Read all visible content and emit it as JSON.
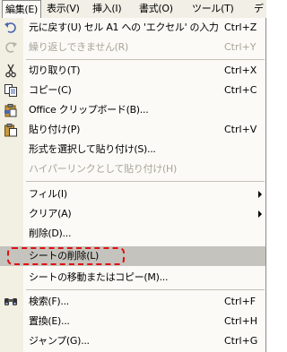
{
  "menubar": {
    "items": [
      {
        "label": "編集(E)"
      },
      {
        "label": "表示(V)"
      },
      {
        "label": "挿入(I)"
      },
      {
        "label": "書式(O)"
      },
      {
        "label": "ツール(T)"
      },
      {
        "label": "デ"
      }
    ]
  },
  "menu": {
    "items": [
      {
        "label": "元に戻す(U) セル A1 への 'エクセル' の入力",
        "shortcut": "Ctrl+Z",
        "icon": "undo-icon"
      },
      {
        "label": "繰り返しできません(R)",
        "shortcut": "Ctrl+Y",
        "icon": "redo-icon",
        "disabled": true
      },
      {
        "label": "切り取り(T)",
        "shortcut": "Ctrl+X",
        "icon": "cut-icon"
      },
      {
        "label": "コピー(C)",
        "shortcut": "Ctrl+C",
        "icon": "copy-icon"
      },
      {
        "label": "Office クリップボード(B)...",
        "icon": "clipboard-icon"
      },
      {
        "label": "貼り付け(P)",
        "shortcut": "Ctrl+V",
        "icon": "paste-icon"
      },
      {
        "label": "形式を選択して貼り付け(S)..."
      },
      {
        "label": "ハイパーリンクとして貼り付け(H)",
        "disabled": true
      },
      {
        "label": "フィル(I)",
        "submenu": true
      },
      {
        "label": "クリア(A)",
        "submenu": true
      },
      {
        "label": "削除(D)..."
      },
      {
        "label": "シートの削除(L)",
        "highlighted": true
      },
      {
        "label": "シートの移動またはコピー(M)..."
      },
      {
        "label": "検索(F)...",
        "shortcut": "Ctrl+F",
        "icon": "find-icon"
      },
      {
        "label": "置換(E)...",
        "shortcut": "Ctrl+H"
      },
      {
        "label": "ジャンプ(G)...",
        "shortcut": "Ctrl+G"
      }
    ]
  },
  "colors": {
    "highlight_annotation": "#e01010",
    "menu_background": "#fbfaf6",
    "gutter": "#f2efe3",
    "disabled_text": "#a7a498",
    "selected_row": "#c5c3bd"
  }
}
